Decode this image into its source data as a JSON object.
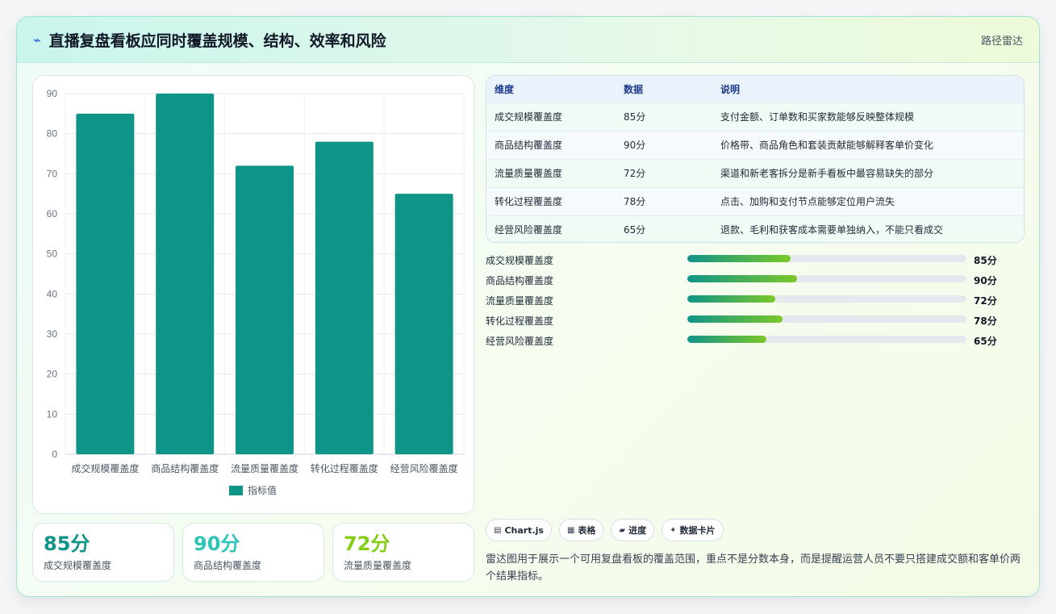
{
  "header": {
    "icon": "lightning-icon",
    "title": "直播复盘看板应同时覆盖规模、结构、效率和风险",
    "right_label": "路径雷达"
  },
  "chart_data": {
    "type": "bar",
    "categories": [
      "成交规模覆盖度",
      "商品结构覆盖度",
      "流量质量覆盖度",
      "转化过程覆盖度",
      "经营风险覆盖度"
    ],
    "series": [
      {
        "name": "指标值",
        "values": [
          85,
          90,
          72,
          78,
          65
        ],
        "color": "#0f9488"
      }
    ],
    "ylim": [
      0,
      90
    ],
    "yticks": [
      0,
      10,
      20,
      30,
      40,
      50,
      60,
      70,
      80,
      90
    ],
    "grid": true,
    "legend": "bottom"
  },
  "stats": [
    {
      "value": "85分",
      "label": "成交规模覆盖度",
      "color": "#0f9488"
    },
    {
      "value": "90分",
      "label": "商品结构覆盖度",
      "color": "#2ec4b6"
    },
    {
      "value": "72分",
      "label": "流量质量覆盖度",
      "color": "#84cc16"
    }
  ],
  "table": {
    "headers": [
      "维度",
      "数据",
      "说明"
    ],
    "rows": [
      [
        "成交规模覆盖度",
        "85分",
        "支付金额、订单数和买家数能够反映整体规模"
      ],
      [
        "商品结构覆盖度",
        "90分",
        "价格带、商品角色和套装贡献能够解释客单价变化"
      ],
      [
        "流量质量覆盖度",
        "72分",
        "渠道和新老客拆分是新手看板中最容易缺失的部分"
      ],
      [
        "转化过程覆盖度",
        "78分",
        "点击、加购和支付节点能够定位用户流失"
      ],
      [
        "经营风险覆盖度",
        "65分",
        "退款、毛利和获客成本需要单独纳入，不能只看成交"
      ]
    ]
  },
  "progress": [
    {
      "label": "成交规模覆盖度",
      "value_text": "85分",
      "fraction": 0.37
    },
    {
      "label": "商品结构覆盖度",
      "value_text": "90分",
      "fraction": 0.393
    },
    {
      "label": "流量质量覆盖度",
      "value_text": "72分",
      "fraction": 0.315
    },
    {
      "label": "转化过程覆盖度",
      "value_text": "78分",
      "fraction": 0.341
    },
    {
      "label": "经营风险覆盖度",
      "value_text": "65分",
      "fraction": 0.283
    }
  ],
  "tags": [
    {
      "icon": "▤",
      "icon_name": "chart-icon",
      "label": "Chart.js"
    },
    {
      "icon": "▦",
      "icon_name": "table-icon",
      "label": "表格"
    },
    {
      "icon": "▰",
      "icon_name": "progress-icon",
      "label": "进度"
    },
    {
      "icon": "✦",
      "icon_name": "sparkle-icon",
      "label": "数据卡片"
    }
  ],
  "description": "雷达图用于展示一个可用复盘看板的覆盖范围，重点不是分数本身，而是提醒运营人员不要只搭建成交额和客单价两个结果指标。"
}
